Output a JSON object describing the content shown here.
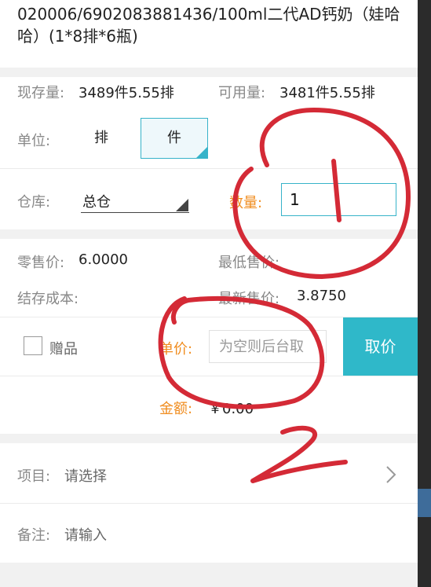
{
  "product": {
    "title": "020006/6902083881436/100ml二代AD钙奶（娃哈哈）(1*8排*6瓶)"
  },
  "stock": {
    "on_hand_label": "现存量:",
    "on_hand_value": "3489件5.55排",
    "available_label": "可用量:",
    "available_value": "3481件5.55排"
  },
  "unit": {
    "label": "单位:",
    "options": [
      "排",
      "件"
    ],
    "selected": "件"
  },
  "warehouse": {
    "label": "仓库:",
    "value": "总仓"
  },
  "quantity": {
    "label": "数量:",
    "value": "1"
  },
  "prices": {
    "retail_label": "零售价:",
    "retail_value": "6.0000",
    "min_price_label": "最低售价:",
    "min_price_value": "",
    "cost_label": "结存成本:",
    "cost_value": "",
    "latest_price_label": "最新售价:",
    "latest_price_value": "3.8750"
  },
  "gift": {
    "label": "赠品"
  },
  "unit_price": {
    "label": "单价:",
    "placeholder": "为空则后台取",
    "button": "取价"
  },
  "amount": {
    "label": "金额:",
    "value": "￥0.00"
  },
  "project": {
    "label": "项目:",
    "placeholder": "请选择"
  },
  "remark": {
    "label": "备注:",
    "placeholder": "请输入"
  },
  "annotations": {
    "mark_1": "1",
    "mark_2": "2",
    "ink_color": "#d42a36"
  },
  "colors": {
    "accent": "#2fb8c9",
    "highlight": "#f08c1e"
  }
}
